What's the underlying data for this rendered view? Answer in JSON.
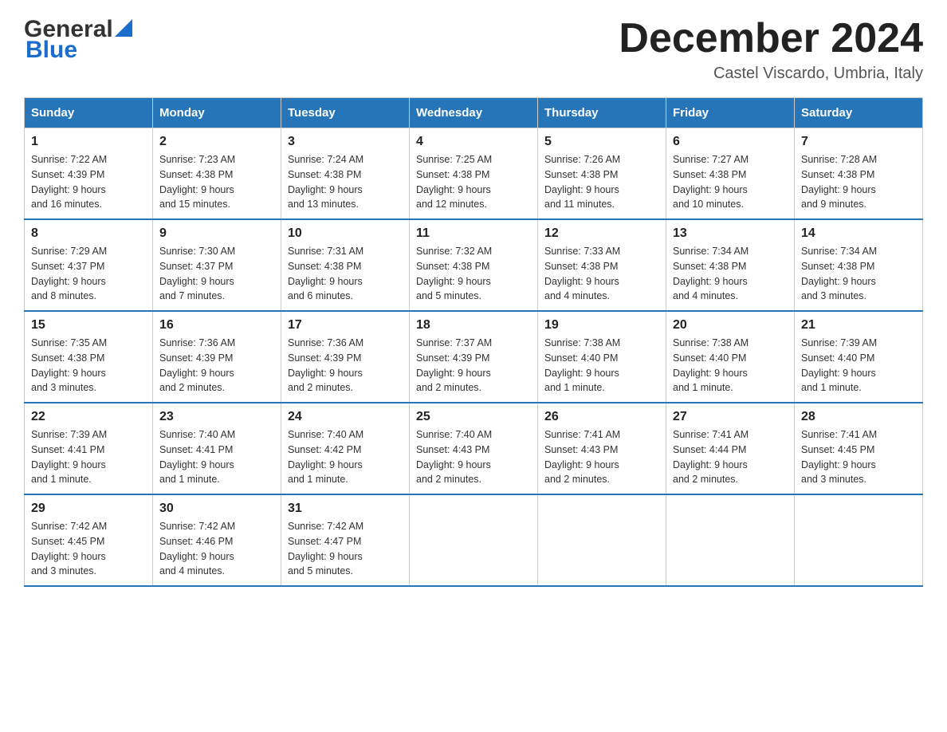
{
  "header": {
    "logo_general": "General",
    "logo_blue": "Blue",
    "month_title": "December 2024",
    "location": "Castel Viscardo, Umbria, Italy"
  },
  "weekdays": [
    "Sunday",
    "Monday",
    "Tuesday",
    "Wednesday",
    "Thursday",
    "Friday",
    "Saturday"
  ],
  "weeks": [
    [
      {
        "day": "1",
        "sunrise": "7:22 AM",
        "sunset": "4:39 PM",
        "daylight": "9 hours and 16 minutes."
      },
      {
        "day": "2",
        "sunrise": "7:23 AM",
        "sunset": "4:38 PM",
        "daylight": "9 hours and 15 minutes."
      },
      {
        "day": "3",
        "sunrise": "7:24 AM",
        "sunset": "4:38 PM",
        "daylight": "9 hours and 13 minutes."
      },
      {
        "day": "4",
        "sunrise": "7:25 AM",
        "sunset": "4:38 PM",
        "daylight": "9 hours and 12 minutes."
      },
      {
        "day": "5",
        "sunrise": "7:26 AM",
        "sunset": "4:38 PM",
        "daylight": "9 hours and 11 minutes."
      },
      {
        "day": "6",
        "sunrise": "7:27 AM",
        "sunset": "4:38 PM",
        "daylight": "9 hours and 10 minutes."
      },
      {
        "day": "7",
        "sunrise": "7:28 AM",
        "sunset": "4:38 PM",
        "daylight": "9 hours and 9 minutes."
      }
    ],
    [
      {
        "day": "8",
        "sunrise": "7:29 AM",
        "sunset": "4:37 PM",
        "daylight": "9 hours and 8 minutes."
      },
      {
        "day": "9",
        "sunrise": "7:30 AM",
        "sunset": "4:37 PM",
        "daylight": "9 hours and 7 minutes."
      },
      {
        "day": "10",
        "sunrise": "7:31 AM",
        "sunset": "4:38 PM",
        "daylight": "9 hours and 6 minutes."
      },
      {
        "day": "11",
        "sunrise": "7:32 AM",
        "sunset": "4:38 PM",
        "daylight": "9 hours and 5 minutes."
      },
      {
        "day": "12",
        "sunrise": "7:33 AM",
        "sunset": "4:38 PM",
        "daylight": "9 hours and 4 minutes."
      },
      {
        "day": "13",
        "sunrise": "7:34 AM",
        "sunset": "4:38 PM",
        "daylight": "9 hours and 4 minutes."
      },
      {
        "day": "14",
        "sunrise": "7:34 AM",
        "sunset": "4:38 PM",
        "daylight": "9 hours and 3 minutes."
      }
    ],
    [
      {
        "day": "15",
        "sunrise": "7:35 AM",
        "sunset": "4:38 PM",
        "daylight": "9 hours and 3 minutes."
      },
      {
        "day": "16",
        "sunrise": "7:36 AM",
        "sunset": "4:39 PM",
        "daylight": "9 hours and 2 minutes."
      },
      {
        "day": "17",
        "sunrise": "7:36 AM",
        "sunset": "4:39 PM",
        "daylight": "9 hours and 2 minutes."
      },
      {
        "day": "18",
        "sunrise": "7:37 AM",
        "sunset": "4:39 PM",
        "daylight": "9 hours and 2 minutes."
      },
      {
        "day": "19",
        "sunrise": "7:38 AM",
        "sunset": "4:40 PM",
        "daylight": "9 hours and 1 minute."
      },
      {
        "day": "20",
        "sunrise": "7:38 AM",
        "sunset": "4:40 PM",
        "daylight": "9 hours and 1 minute."
      },
      {
        "day": "21",
        "sunrise": "7:39 AM",
        "sunset": "4:40 PM",
        "daylight": "9 hours and 1 minute."
      }
    ],
    [
      {
        "day": "22",
        "sunrise": "7:39 AM",
        "sunset": "4:41 PM",
        "daylight": "9 hours and 1 minute."
      },
      {
        "day": "23",
        "sunrise": "7:40 AM",
        "sunset": "4:41 PM",
        "daylight": "9 hours and 1 minute."
      },
      {
        "day": "24",
        "sunrise": "7:40 AM",
        "sunset": "4:42 PM",
        "daylight": "9 hours and 1 minute."
      },
      {
        "day": "25",
        "sunrise": "7:40 AM",
        "sunset": "4:43 PM",
        "daylight": "9 hours and 2 minutes."
      },
      {
        "day": "26",
        "sunrise": "7:41 AM",
        "sunset": "4:43 PM",
        "daylight": "9 hours and 2 minutes."
      },
      {
        "day": "27",
        "sunrise": "7:41 AM",
        "sunset": "4:44 PM",
        "daylight": "9 hours and 2 minutes."
      },
      {
        "day": "28",
        "sunrise": "7:41 AM",
        "sunset": "4:45 PM",
        "daylight": "9 hours and 3 minutes."
      }
    ],
    [
      {
        "day": "29",
        "sunrise": "7:42 AM",
        "sunset": "4:45 PM",
        "daylight": "9 hours and 3 minutes."
      },
      {
        "day": "30",
        "sunrise": "7:42 AM",
        "sunset": "4:46 PM",
        "daylight": "9 hours and 4 minutes."
      },
      {
        "day": "31",
        "sunrise": "7:42 AM",
        "sunset": "4:47 PM",
        "daylight": "9 hours and 5 minutes."
      },
      null,
      null,
      null,
      null
    ]
  ],
  "labels": {
    "sunrise": "Sunrise:",
    "sunset": "Sunset:",
    "daylight": "Daylight:"
  }
}
